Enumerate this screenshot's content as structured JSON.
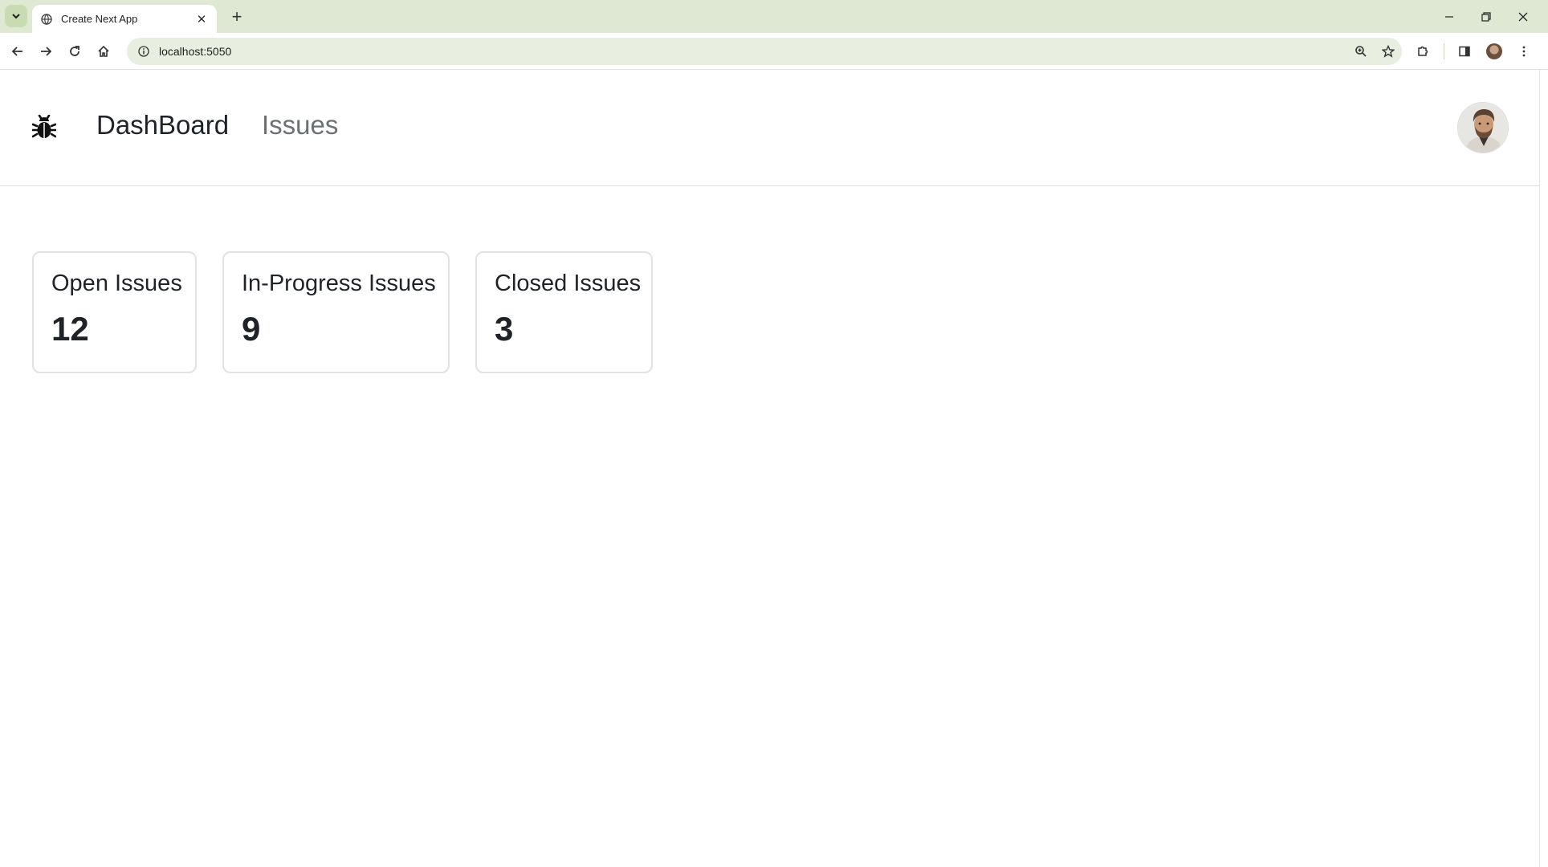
{
  "browser": {
    "tab_title": "Create Next App",
    "url": "localhost:5050"
  },
  "navbar": {
    "links": [
      {
        "label": "DashBoard"
      },
      {
        "label": "Issues"
      }
    ]
  },
  "summary": {
    "cards": [
      {
        "label": "Open Issues",
        "value": "12"
      },
      {
        "label": "In-Progress Issues",
        "value": "9"
      },
      {
        "label": "Closed Issues",
        "value": "3"
      }
    ]
  },
  "icons": {
    "logo": "bug-icon",
    "avatar": "user-avatar"
  }
}
